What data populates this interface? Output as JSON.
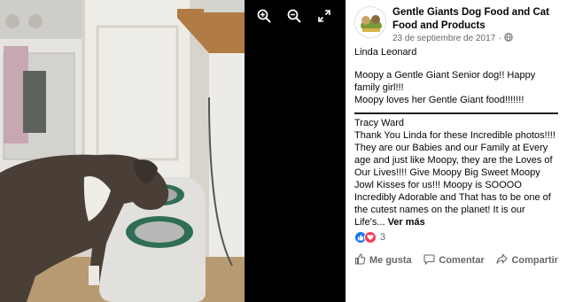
{
  "post": {
    "page_name": "Gentle Giants Dog Food and Cat Food and Products",
    "date": "23 de septiembre de 2017",
    "separator": "·",
    "privacy_icon": "globe-icon",
    "author": "Linda Leonard",
    "caption_lines": [
      "Moopy a Gentle Giant Senior dog!! Happy",
      "family girl!!!",
      "Moopy loves her Gentle Giant food!!!!!!!"
    ]
  },
  "comment": {
    "author": "Tracy Ward",
    "text": "Thank You Linda for these Incredible photos!!!! They are our Babies and our Family at Every age and just like Moopy, they are the Loves of Our Lives!!!! Give Moopy Big Sweet Moopy Jowl Kisses for us!!! Moopy is SOOOO Incredibly Adorable and That has to be one of the cutest names on the planet! It is our Life's...",
    "see_more": "Ver más"
  },
  "reactions": {
    "types": [
      "like",
      "love"
    ],
    "count": "3"
  },
  "actions": {
    "like": "Me gusta",
    "comment": "Comentar",
    "share": "Compartir"
  },
  "viewer": {
    "controls": [
      "zoom-in-icon",
      "zoom-out-icon",
      "fullscreen-icon"
    ]
  },
  "colors": {
    "viewer_bg": "#000000",
    "meta_text": "#65676b",
    "like_blue": "#1877f2",
    "love_red": "#f33e58"
  }
}
